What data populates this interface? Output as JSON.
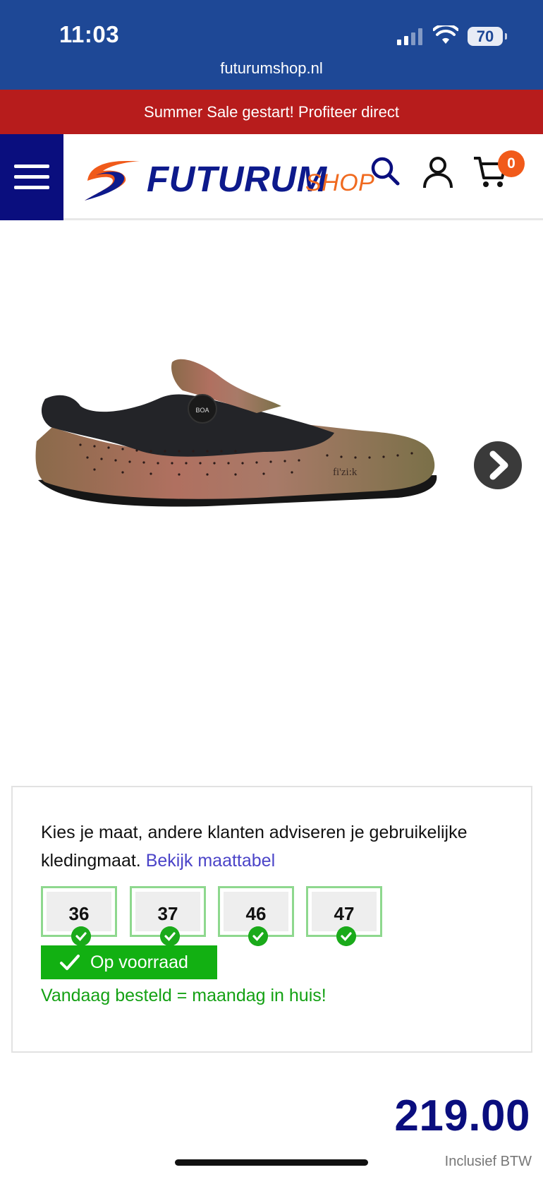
{
  "status_bar": {
    "time": "11:03",
    "url": "futurumshop.nl",
    "battery": "70"
  },
  "promo": {
    "text": "Summer Sale gestart! Profiteer direct"
  },
  "header": {
    "logo_main": "FUTURUM",
    "logo_sub": "SHOP",
    "cart_count": "0",
    "icons": [
      "menu-icon",
      "search-icon",
      "user-icon",
      "cart-icon"
    ]
  },
  "product": {
    "image_icon": "shoe-image",
    "next_icon": "chevron-right-icon"
  },
  "size_selector": {
    "intro": "Kies je maat, andere klanten adviseren je gebruikelijke kledingmaat.",
    "link": "Bekijk maattabel",
    "sizes": [
      "36",
      "37",
      "46",
      "47"
    ],
    "stock": "Op voorraad",
    "delivery": "Vandaag besteld = maandag in huis!"
  },
  "price": {
    "amount": "219.00",
    "vat_note": "Inclusief BTW"
  },
  "colors": {
    "brand_blue": "#0a0e7e",
    "status_blue": "#1e4896",
    "promo_red": "#b71c1c",
    "accent_orange": "#f15a1a",
    "stock_green": "#12b012"
  }
}
